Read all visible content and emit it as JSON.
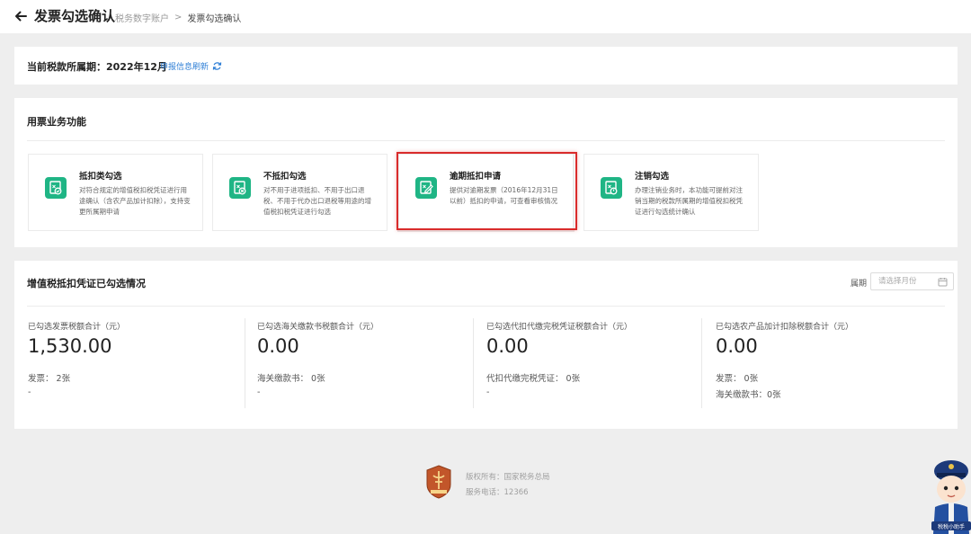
{
  "header": {
    "title": "发票勾选确认",
    "breadcrumb": {
      "parent": "税务数字账户",
      "separator": ">",
      "current": "发票勾选确认"
    }
  },
  "period": {
    "label": "当前税款所属期：2022年12月",
    "refresh_link": "申报信息刷新"
  },
  "functions": {
    "section_title": "用票业务功能",
    "selected_index": 2,
    "items": [
      {
        "name": "抵扣类勾选",
        "desc": "对符合规定的增值税扣税凭证进行用途确认（含农产品加计扣除），支持变更所属期申请",
        "icon": "invoice-check-icon"
      },
      {
        "name": "不抵扣勾选",
        "desc": "对不用于进项抵扣、不用于出口退税、不用于代办出口退税等用途的增值税扣税凭证进行勾选",
        "icon": "invoice-cancel-icon"
      },
      {
        "name": "逾期抵扣申请",
        "desc": "提供对逾期发票（2016年12月31日以前）抵扣的申请，可查看审核情况",
        "icon": "invoice-edit-icon"
      },
      {
        "name": "注销勾选",
        "desc": "办理注销业务时，本功能可提前对注销当期的税款所属期的增值税扣税凭证进行勾选统计确认",
        "icon": "invoice-power-icon"
      }
    ]
  },
  "summary": {
    "title": "增值税抵扣凭证已勾选情况",
    "filter_label": "属期",
    "filter_placeholder": "请选择月份",
    "stats": [
      {
        "label": "已勾选发票税额合计（元）",
        "value": "1,530.00",
        "details": [
          {
            "text": "发票：  2张"
          }
        ],
        "dash": "-"
      },
      {
        "label": "已勾选海关缴款书税额合计（元）",
        "value": "0.00",
        "details": [
          {
            "text": "海关缴款书：  0张"
          }
        ],
        "dash": "-"
      },
      {
        "label": "已勾选代扣代缴完税凭证税额合计（元）",
        "value": "0.00",
        "details": [
          {
            "text": "代扣代缴完税凭证：  0张"
          }
        ],
        "dash": "-"
      },
      {
        "label": "已勾选农产品加计扣除税额合计（元）",
        "value": "0.00",
        "details": [
          {
            "text": "发票：  0张"
          },
          {
            "text": "海关缴款书：0张"
          }
        ],
        "dash": ""
      }
    ]
  },
  "footer": {
    "copyright": "版权所有：国家税务总局",
    "phone": "服务电话：12366"
  },
  "assistant_label": "税税小助手",
  "colors": {
    "accent": "#2f7fd6",
    "icon_bg": "#1fb585",
    "highlight": "#d92b2b"
  }
}
